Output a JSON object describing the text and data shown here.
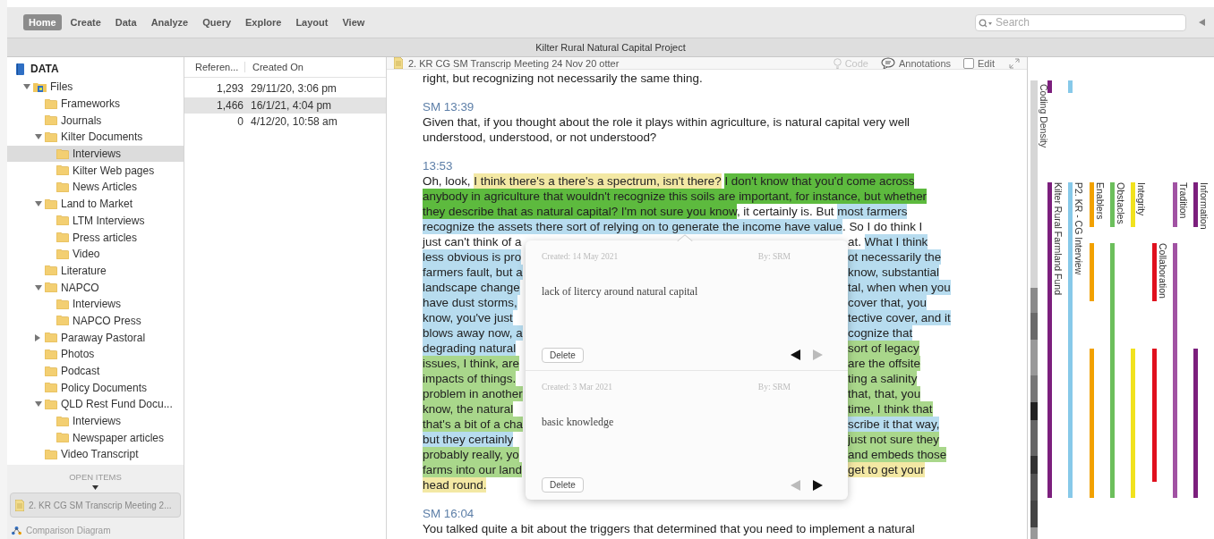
{
  "tabs": [
    {
      "label": "Home",
      "selected": true
    },
    {
      "label": "Create",
      "selected": false
    },
    {
      "label": "Data",
      "selected": false
    },
    {
      "label": "Analyze",
      "selected": false
    },
    {
      "label": "Query",
      "selected": false
    },
    {
      "label": "Explore",
      "selected": false
    },
    {
      "label": "Layout",
      "selected": false
    },
    {
      "label": "View",
      "selected": false
    }
  ],
  "search": {
    "placeholder": "Search"
  },
  "window": {
    "title": "Kilter Rural Natural Capital Project"
  },
  "sidebar": {
    "title": "DATA",
    "tree": [
      {
        "label": "Files",
        "kind": "files",
        "expanded": true,
        "selected": false,
        "children": [
          {
            "label": "Frameworks",
            "kind": "folder",
            "selected": false
          },
          {
            "label": "Journals",
            "kind": "folder",
            "selected": false
          },
          {
            "label": "Kilter Documents",
            "kind": "folder",
            "expanded": true,
            "selected": false,
            "children": [
              {
                "label": "Interviews",
                "kind": "folder",
                "selected": true
              },
              {
                "label": "Kilter Web pages",
                "kind": "folder",
                "selected": false
              },
              {
                "label": "News Articles",
                "kind": "folder",
                "selected": false
              }
            ]
          },
          {
            "label": "Land to Market",
            "kind": "folder",
            "expanded": true,
            "selected": false,
            "children": [
              {
                "label": "LTM Interviews",
                "kind": "folder",
                "selected": false
              },
              {
                "label": "Press articles",
                "kind": "folder",
                "selected": false
              },
              {
                "label": "Video",
                "kind": "folder",
                "selected": false
              }
            ]
          },
          {
            "label": "Literature",
            "kind": "folder",
            "selected": false
          },
          {
            "label": "NAPCO",
            "kind": "folder",
            "expanded": true,
            "selected": false,
            "children": [
              {
                "label": "Interviews",
                "kind": "folder",
                "selected": false
              },
              {
                "label": "NAPCO Press",
                "kind": "folder",
                "selected": false
              }
            ]
          },
          {
            "label": "Paraway Pastoral",
            "kind": "folder",
            "expanded": false,
            "selected": false
          },
          {
            "label": "Photos",
            "kind": "folder",
            "selected": false
          },
          {
            "label": "Podcast",
            "kind": "folder",
            "selected": false
          },
          {
            "label": "Policy Documents",
            "kind": "folder",
            "selected": false
          },
          {
            "label": "QLD Rest Fund Docu...",
            "kind": "folder",
            "expanded": true,
            "selected": false,
            "children": [
              {
                "label": "Interviews",
                "kind": "folder",
                "selected": false
              },
              {
                "label": "Newspaper articles",
                "kind": "folder",
                "selected": false
              }
            ]
          },
          {
            "label": "Video Transcript",
            "kind": "folder",
            "selected": false
          }
        ]
      }
    ],
    "open_items_title": "OPEN ITEMS",
    "open_items": [
      {
        "label": "2. KR CG SM Transcrip Meeting 2...",
        "kind": "document"
      },
      {
        "label": "Comparison Diagram",
        "kind": "diagram"
      }
    ]
  },
  "table": {
    "columns": [
      "Referen...",
      "Created On"
    ],
    "rows": [
      {
        "references": "1,293",
        "created_on": "29/11/20, 3:06 pm",
        "selected": false
      },
      {
        "references": "1,466",
        "created_on": "16/1/21, 4:04 pm",
        "selected": true
      },
      {
        "references": "0",
        "created_on": "4/12/20, 10:58 am",
        "selected": false
      }
    ]
  },
  "document": {
    "title": "2. KR CG SM Transcrip Meeting 24 Nov 20 otter",
    "code": {
      "label": "Code",
      "disabled": true
    },
    "annotations": {
      "label": "Annotations"
    },
    "edit": {
      "label": "Edit",
      "checked": false
    },
    "transcript": [
      {
        "text": "right, but recognizing not necessarily the same thing."
      },
      {
        "speaker": "SM 13:39",
        "text": "Given that, if you thought about the role it plays within agriculture,  is natural capital very well understood, understood, or not understood?"
      },
      {
        "speaker": "13:53",
        "lines": [
          {
            "full": [
              {
                "text": "Oh, look, "
              },
              {
                "text": "I think there's a there's a spectrum, isn't there?",
                "color": "#f3e8a4"
              },
              {
                "text": "I don't know that you'd come across",
                "color": "#5dba3e"
              }
            ]
          },
          {
            "full": [
              {
                "text": "anybody in agriculture that wouldn't recognize this soils are important, for instance, but whether",
                "color": "#5dba3e"
              }
            ]
          },
          {
            "full": [
              {
                "text": "they describe that as natural capital? I'm not sure you know",
                "color": "#5dba3e"
              },
              {
                "text": ", it certainly is. But "
              },
              {
                "text": "most farmers",
                "color": "#b7dcef"
              }
            ]
          },
          {
            "full": [
              {
                "text": "recognize the assets there sort of relying on to generate the income have value",
                "color": "#b7dcef"
              },
              {
                "text": ". So I do think I"
              }
            ]
          },
          {
            "left": [
              {
                "text": "just can't think of a"
              }
            ],
            "right": [
              {
                "text": "at. "
              },
              {
                "text": "What I think",
                "color": "#b7dcef"
              }
            ]
          },
          {
            "left": [
              {
                "text": "less obvious is pro",
                "color": "#b7dcef"
              }
            ],
            "right": [
              {
                "text": "ot necessarily the",
                "color": "#b7dcef"
              }
            ]
          },
          {
            "left": [
              {
                "text": "farmers fault, but a",
                "color": "#b7dcef"
              }
            ],
            "right": [
              {
                "text": "know, substantial",
                "color": "#b7dcef"
              }
            ]
          },
          {
            "left": [
              {
                "text": "landscape change",
                "color": "#b7dcef"
              }
            ],
            "right": [
              {
                "text": "tal, when when you",
                "color": "#b7dcef"
              }
            ]
          },
          {
            "left": [
              {
                "text": "have dust storms,",
                "color": "#b7dcef"
              }
            ],
            "right": [
              {
                "text": "cover that, you",
                "color": "#b7dcef"
              }
            ]
          },
          {
            "left": [
              {
                "text": "know, you've just",
                "color": "#b7dcef"
              }
            ],
            "right": [
              {
                "text": "tective cover, and it",
                "color": "#b7dcef"
              }
            ]
          },
          {
            "left": [
              {
                "text": "blows away now, a",
                "color": "#b7dcef"
              }
            ],
            "right": [
              {
                "text": "cognize that",
                "color": "#b7dcef"
              }
            ]
          },
          {
            "left": [
              {
                "text": "degrading natural",
                "color": "#b7dcef"
              }
            ],
            "right": [
              {
                "text": "sort of legacy",
                "color": "#a9d78b"
              }
            ]
          },
          {
            "left": [
              {
                "text": "issues, I think, are",
                "color": "#a9d78b"
              }
            ],
            "right": [
              {
                "text": "are the offsite",
                "color": "#a9d78b"
              }
            ]
          },
          {
            "left": [
              {
                "text": "impacts of things.",
                "color": "#a9d78b"
              }
            ],
            "right": [
              {
                "text": "ting a salinity",
                "color": "#a9d78b"
              }
            ]
          },
          {
            "left": [
              {
                "text": "problem in another",
                "color": "#a9d78b"
              }
            ],
            "right": [
              {
                "text": "that, that, you",
                "color": "#a9d78b"
              }
            ]
          },
          {
            "left": [
              {
                "text": "know, the natural",
                "color": "#a9d78b"
              }
            ],
            "right": [
              {
                "text": "time, I think that",
                "color": "#a9d78b"
              }
            ]
          },
          {
            "left": [
              {
                "text": "that's a bit of a cha",
                "color": "#a9d78b"
              }
            ],
            "right": [
              {
                "text": "scribe it that way,",
                "color": "#b7dcef"
              }
            ]
          },
          {
            "left": [
              {
                "text": "but they certainly",
                "color": "#b7dcef"
              }
            ],
            "right": [
              {
                "text": "just not sure they",
                "color": "#a9d78b"
              }
            ]
          },
          {
            "left": [
              {
                "text": "probably really, yo",
                "color": "#a9d78b"
              }
            ],
            "right": [
              {
                "text": "and embeds those",
                "color": "#a9d78b"
              }
            ]
          },
          {
            "left": [
              {
                "text": "farms into our land",
                "color": "#a9d78b"
              }
            ],
            "right": [
              {
                "text": "get to get your",
                "color": "#f3e8a4"
              }
            ]
          },
          {
            "full": [
              {
                "text": "head round.",
                "color": "#f3e8a4"
              }
            ]
          }
        ]
      },
      {
        "speaker": "SM 16:04",
        "text": "You talked quite a bit about the triggers that determined that you need to implement a natural"
      }
    ],
    "annotations_popup": [
      {
        "created": "Created: 14 May 2021",
        "by": "By: SRM",
        "text": "lack of litercy around natural capital",
        "button": "Delete",
        "prev_enabled": true,
        "next_enabled": false
      },
      {
        "created": "Created: 3 Mar 2021",
        "by": "By: SRM",
        "text": "basic knowledge",
        "button": "Delete",
        "prev_enabled": false,
        "next_enabled": true
      }
    ]
  },
  "coding_stripes": {
    "density_label": "Coding Density",
    "stripes": [
      {
        "label": "Kilter Rural Farmland Fund",
        "color": "#7c1f7d"
      },
      {
        "label": "P2. KR - CG Interview",
        "color": "#87c9e9"
      },
      {
        "label": "Enablers",
        "color": "#f2a100"
      },
      {
        "label": "Obstacles",
        "color": "#6cbf5c"
      },
      {
        "label": "Integrity",
        "color": "#f1e21e"
      },
      {
        "label": "Collaboration",
        "color": "#e0101e"
      },
      {
        "label": "Tradition",
        "color": "#a152a3"
      },
      {
        "label": "Information",
        "color": "#7c1f7d"
      }
    ]
  }
}
